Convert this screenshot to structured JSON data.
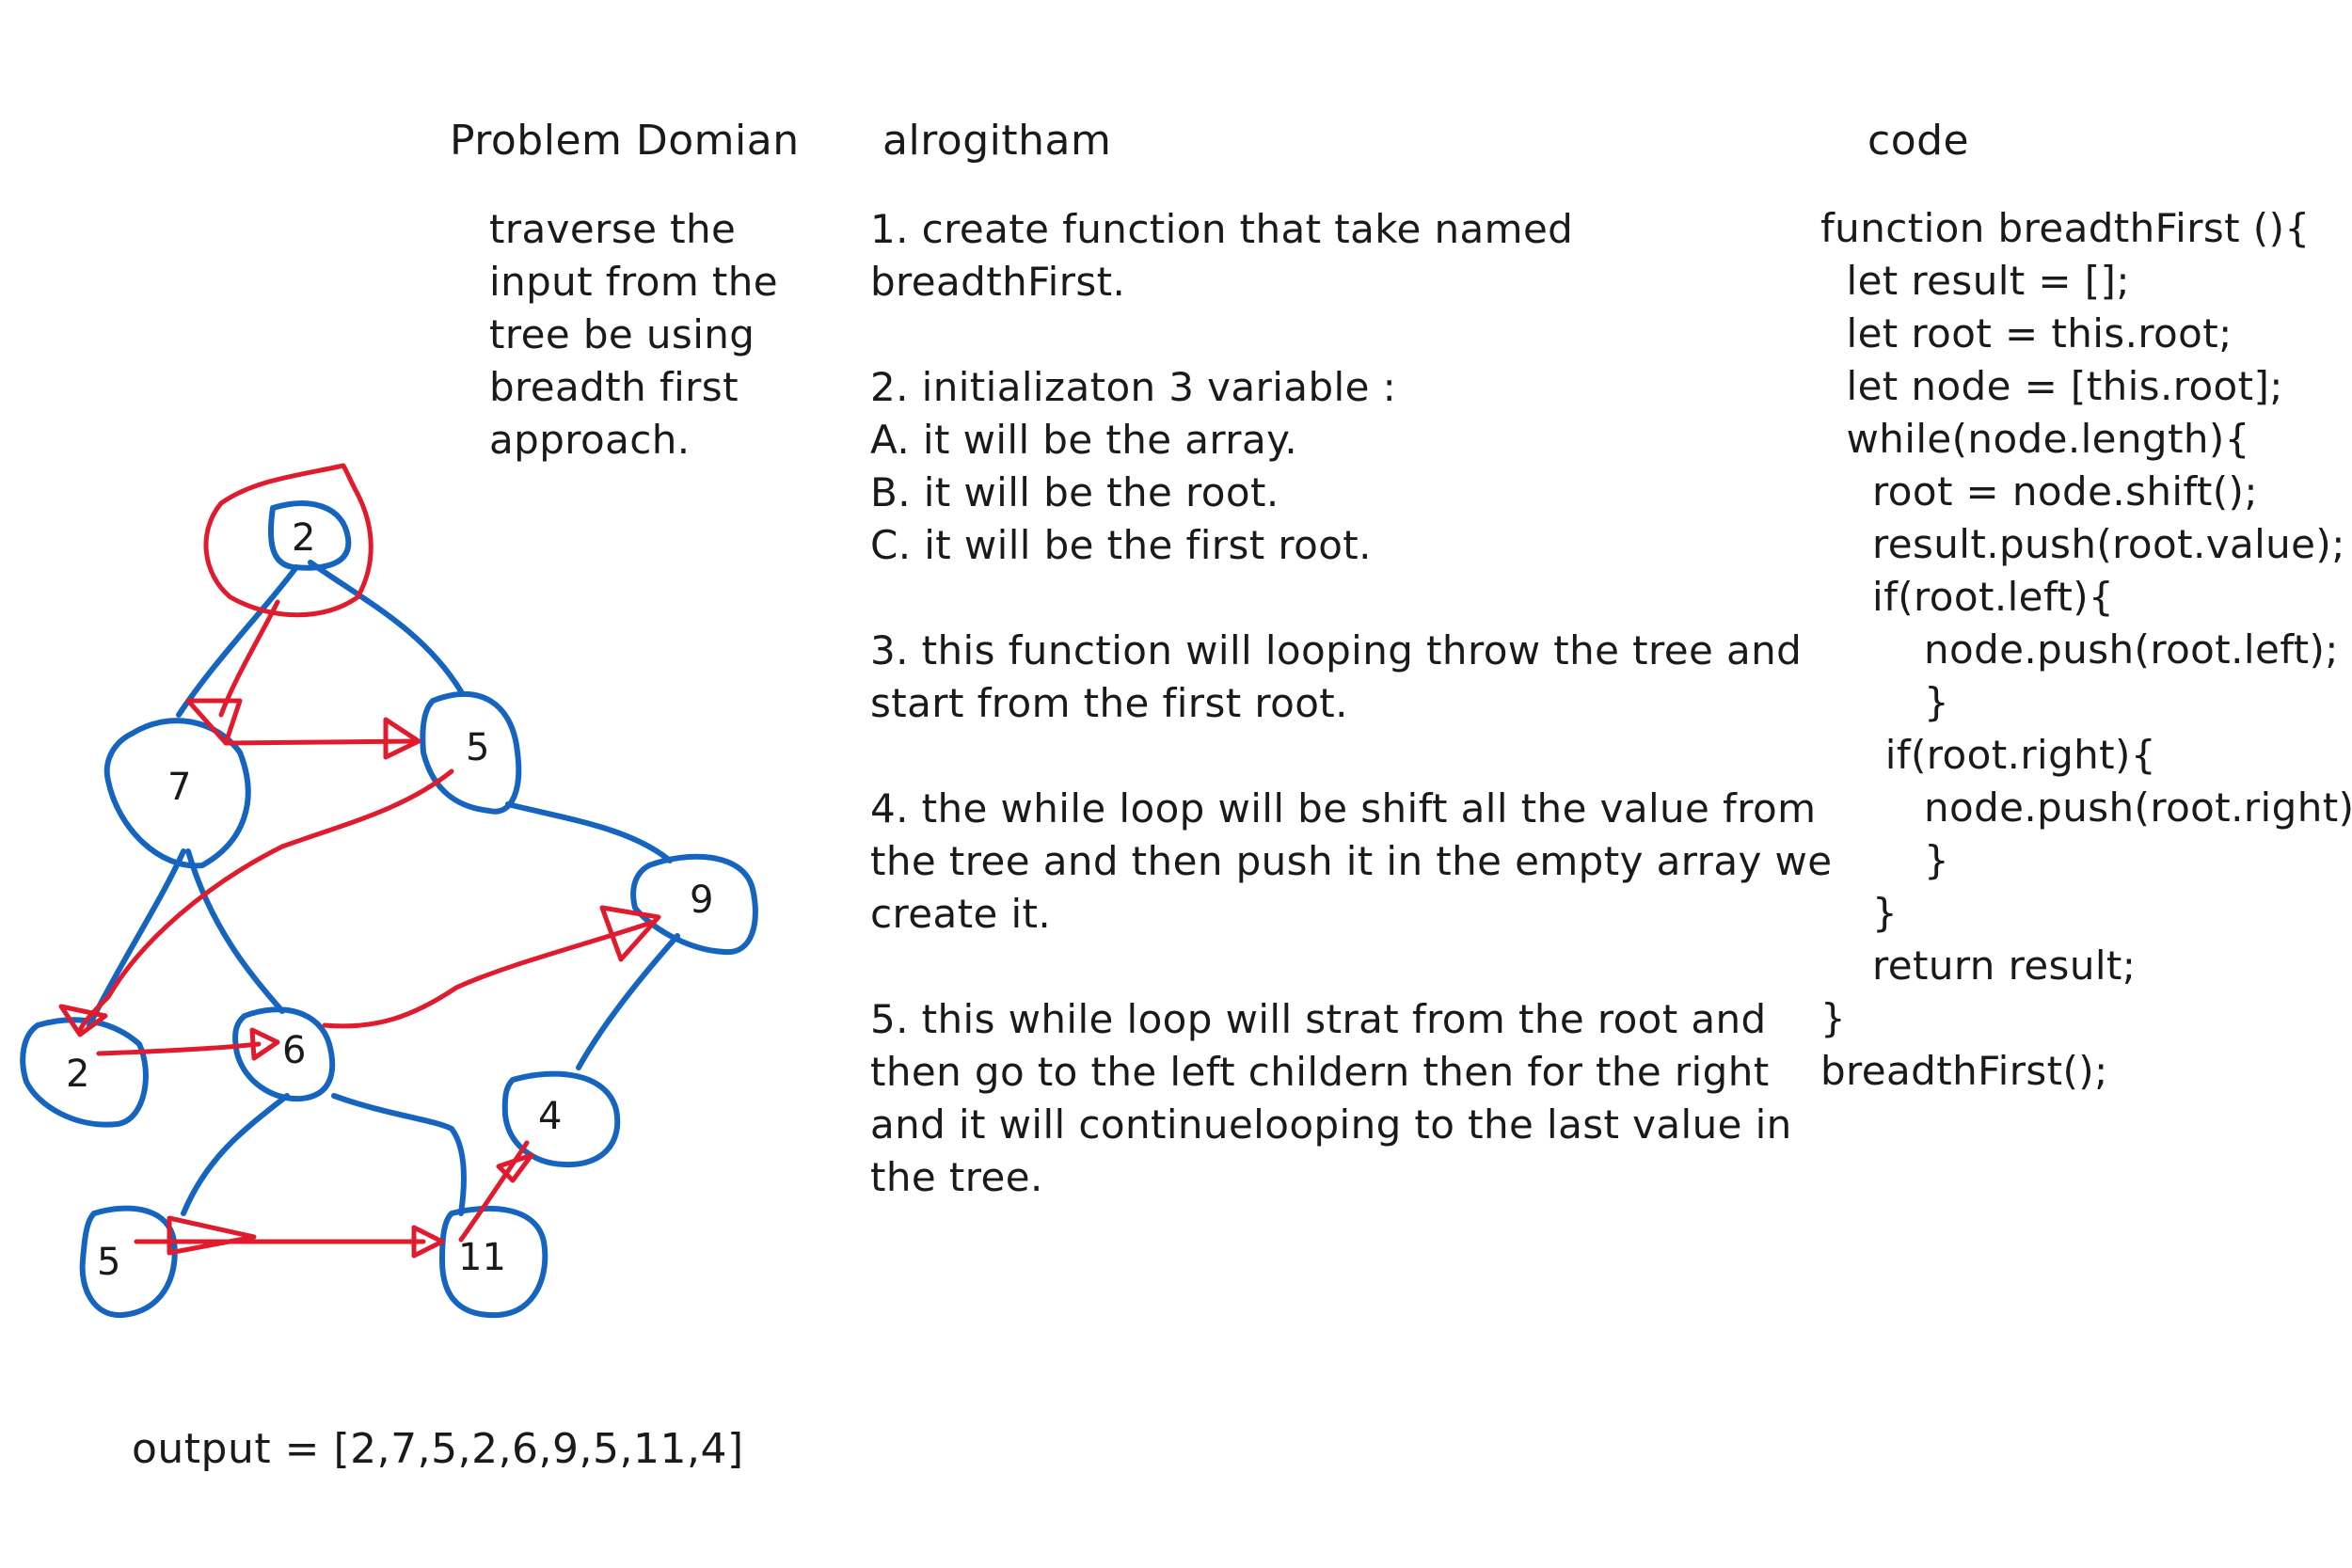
{
  "headings": {
    "problem": "Problem Domian",
    "algorithm": "alrogitham",
    "code": "code"
  },
  "problem_domain": [
    "traverse the",
    "input from the",
    "tree be using",
    "breadth first",
    "approach."
  ],
  "algorithm_steps": {
    "step1": [
      "1. create function that take named",
      "breadthFirst."
    ],
    "step2": [
      "2. initializaton 3 variable :",
      "A. it will be the array.",
      "B. it will be the root.",
      "C. it will be the first root."
    ],
    "step3": [
      "3. this function will looping throw the tree and",
      "start from the first root."
    ],
    "step4": [
      "4. the while loop will be shift all the value from",
      "the tree and then push it in the empty array we",
      "create it."
    ],
    "step5": [
      "5. this while loop will strat from the root and",
      "then go to the left childern then for the right",
      "and it will continuelooping to the last value in",
      "the tree."
    ]
  },
  "code_lines": [
    "function breadthFirst (){",
    "  let result = [];",
    "  let root = this.root;",
    "  let node = [this.root];",
    "  while(node.length){",
    "    root = node.shift();",
    "    result.push(root.value);",
    "    if(root.left){",
    "        node.push(root.left);",
    "        }",
    "     if(root.right){",
    "        node.push(root.right)",
    "        }",
    "    }",
    "    return result;",
    "}",
    "breadthFirst();"
  ],
  "tree": {
    "nodes": [
      {
        "id": "n2root",
        "label": "2"
      },
      {
        "id": "n7",
        "label": "7"
      },
      {
        "id": "n5",
        "label": "5"
      },
      {
        "id": "n2",
        "label": "2"
      },
      {
        "id": "n6",
        "label": "6"
      },
      {
        "id": "n9",
        "label": "9"
      },
      {
        "id": "n5b",
        "label": "5"
      },
      {
        "id": "n11",
        "label": "11"
      },
      {
        "id": "n4",
        "label": "4"
      }
    ],
    "edge_color": "#1565c0",
    "traversal_color": "#e01b2d"
  },
  "output": "output = [2,7,5,2,6,9,5,11,4]"
}
